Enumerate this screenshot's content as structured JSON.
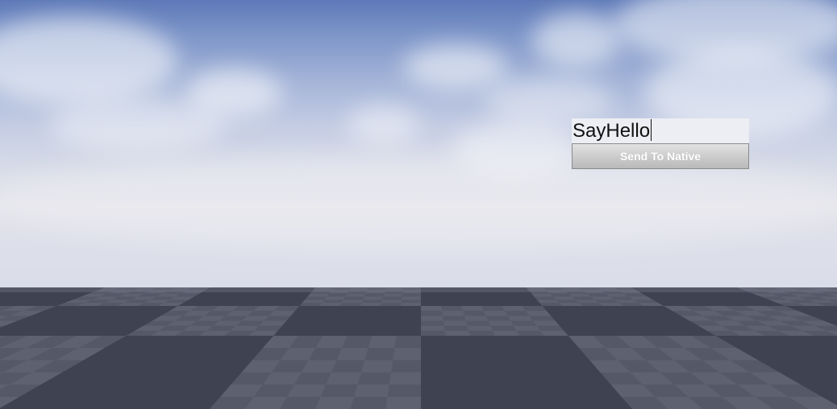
{
  "scene": {
    "sky_colors": {
      "top": "#5d79b8",
      "horizon": "#e3e3ea"
    },
    "floor_colors": {
      "dark": "#3f4250",
      "light": "#555967",
      "light_alt": "#5d6170"
    }
  },
  "ui": {
    "text_input": {
      "value": "SayHello"
    },
    "send_button": {
      "label": "Send To Native"
    }
  }
}
